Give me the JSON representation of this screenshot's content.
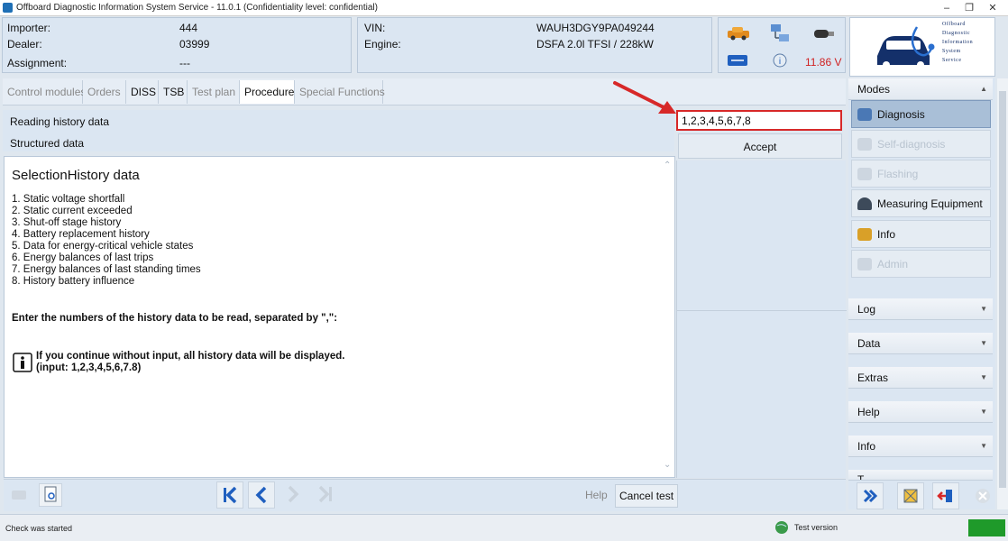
{
  "window": {
    "title": "Offboard Diagnostic Information System Service - 11.0.1 (Confidentiality level: confidential)"
  },
  "header": {
    "importer_label": "Importer:",
    "importer_value": "444",
    "dealer_label": "Dealer:",
    "dealer_value": "03999",
    "assignment_label": "Assignment:",
    "assignment_value": "---",
    "vin_label": "VIN:",
    "vin_value": "WAUH3DGY9PA049244",
    "engine_label": "Engine:",
    "engine_value": "DSFA 2.0l TFSI / 228kW",
    "battery_voltage": "11.86 V",
    "logo_lines": [
      "Offboard",
      "Diagnostic",
      "Information",
      "System",
      "Service"
    ]
  },
  "tabs": [
    {
      "label": "Control modules"
    },
    {
      "label": "Orders"
    },
    {
      "label": "DISS"
    },
    {
      "label": "TSB"
    },
    {
      "label": "Test plan"
    },
    {
      "label": "Procedure"
    },
    {
      "label": "Special Functions"
    }
  ],
  "main": {
    "row1": "Reading history data",
    "row2": "Structured data",
    "heading": "SelectionHistory data",
    "items": [
      "1. Static voltage shortfall",
      "2. Static current exceeded",
      "3. Shut-off stage history",
      "4. Battery replacement history",
      "5. Data for energy-critical vehicle states",
      "6. Energy balances of last trips",
      "7. Energy balances of last standing times",
      "8. History battery influence"
    ],
    "prompt": "Enter the numbers of the history data to be read, separated by \",\":",
    "info_line1": "If you continue without input, all history data will be displayed.",
    "info_line2": "(input: 1,2,3,4,5,6,7.8)"
  },
  "input": {
    "value": "1,2,3,4,5,6,7,8",
    "accept_label": "Accept"
  },
  "sidebar": {
    "modes_label": "Modes",
    "modes": [
      {
        "label": "Diagnosis"
      },
      {
        "label": "Self-diagnosis"
      },
      {
        "label": "Flashing"
      },
      {
        "label": "Measuring Equipment"
      },
      {
        "label": "Info"
      },
      {
        "label": "Admin"
      }
    ],
    "sections": [
      {
        "label": "Log"
      },
      {
        "label": "Data"
      },
      {
        "label": "Extras"
      },
      {
        "label": "Help"
      },
      {
        "label": "Info"
      },
      {
        "label": "T..."
      }
    ]
  },
  "bottom": {
    "help_label": "Help",
    "cancel_label": "Cancel test"
  },
  "status": {
    "left_text": "Check was started",
    "right_text": "Test version"
  },
  "colors": {
    "accent": "#1f5fbf",
    "warning": "#d72828",
    "status_ok": "#1f9a2a"
  }
}
